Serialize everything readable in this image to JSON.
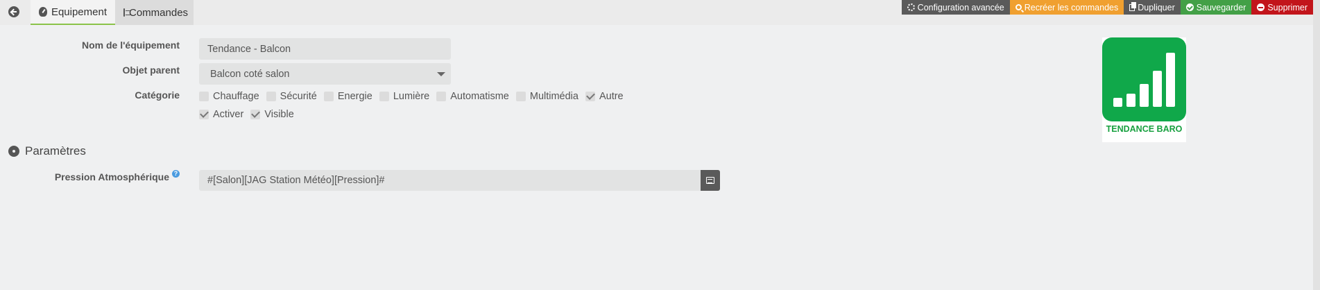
{
  "tabs": [
    {
      "label": "Equipement",
      "icon": "gauge-icon",
      "active": true
    },
    {
      "label": "Commandes",
      "icon": "list-icon",
      "active": false
    }
  ],
  "actions": {
    "config": "Configuration avancée",
    "recreate": "Recréer les commandes",
    "duplicate": "Dupliquer",
    "save": "Sauvegarder",
    "delete": "Supprimer"
  },
  "colors": {
    "config": "#5a5a5a",
    "recreate": "#f0a030",
    "save": "#43a047",
    "delete": "#c2151b",
    "logo_green": "#10a84a"
  },
  "form": {
    "name_label": "Nom de l'équipement",
    "name_value": "Tendance - Balcon",
    "parent_label": "Objet parent",
    "parent_value": "Balcon coté salon",
    "category_label": "Catégorie",
    "categories": [
      {
        "label": "Chauffage",
        "checked": false
      },
      {
        "label": "Sécurité",
        "checked": false
      },
      {
        "label": "Energie",
        "checked": false
      },
      {
        "label": "Lumière",
        "checked": false
      },
      {
        "label": "Automatisme",
        "checked": false
      },
      {
        "label": "Multimédia",
        "checked": false
      },
      {
        "label": "Autre",
        "checked": true
      }
    ],
    "activer": {
      "label": "Activer",
      "checked": true
    },
    "visible": {
      "label": "Visible",
      "checked": true
    }
  },
  "params": {
    "section_title": "Paramètres",
    "pression_label": "Pression Atmosphérique",
    "pression_value": "#[Salon][JAG Station Météo][Pression]#",
    "help_glyph": "?"
  },
  "logo": {
    "text": "TENDANCE BARO"
  }
}
